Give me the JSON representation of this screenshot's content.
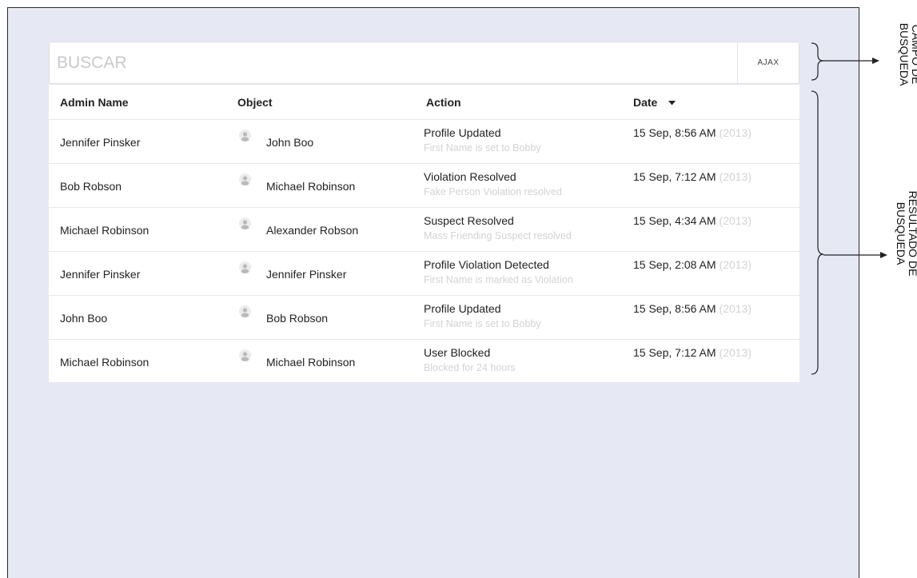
{
  "search": {
    "placeholder": "BUSCAR",
    "button_label": "AJAX"
  },
  "table": {
    "headers": {
      "admin": "Admin Name",
      "object": "Object",
      "action": "Action",
      "date": "Date"
    },
    "rows": [
      {
        "admin": "Jennifer Pinsker",
        "object": "John Boo",
        "action": "Profile Updated",
        "detail": "First Name is set to Bobby",
        "date": "15 Sep, 8:56 AM",
        "year": "(2013)"
      },
      {
        "admin": "Bob Robson",
        "object": "Michael Robinson",
        "action": "Violation Resolved",
        "detail": "Fake Person Violation resolved",
        "date": "15 Sep, 7:12 AM",
        "year": "(2013)"
      },
      {
        "admin": "Michael Robinson",
        "object": "Alexander Robson",
        "action": "Suspect Resolved",
        "detail": "Mass Friending Suspect resolved",
        "date": "15 Sep, 4:34 AM",
        "year": "(2013)"
      },
      {
        "admin": "Jennifer Pinsker",
        "object": "Jennifer Pinsker",
        "action": "Profile Violation Detected",
        "detail": "First Name is marked as Violation",
        "date": "15 Sep, 2:08 AM",
        "year": "(2013)"
      },
      {
        "admin": "John Boo",
        "object": "Bob Robson",
        "action": "Profile Updated",
        "detail": "First Name is set to Bobby",
        "date": "15 Sep, 8:56 AM",
        "year": "(2013)"
      },
      {
        "admin": "Michael Robinson",
        "object": "Michael Robinson",
        "action": "User Blocked",
        "detail": "Blocked for 24 hours",
        "date": "15 Sep, 7:12 AM",
        "year": "(2013)"
      }
    ]
  },
  "annotations": {
    "search_field": {
      "line1": "CAMPO DE",
      "line2": "BUSQUEDA"
    },
    "search_results": {
      "line1": "RESULTADO DE",
      "line2": "BUSQUEDA"
    }
  },
  "icons": {
    "avatar": "user-avatar-icon",
    "sort": "caret-down-icon",
    "arrow": "arrow-right-icon"
  },
  "colors": {
    "canvas_bg": "#e6e8f4",
    "muted_text": "#d3d3d8",
    "placeholder": "#c9c9cf"
  }
}
